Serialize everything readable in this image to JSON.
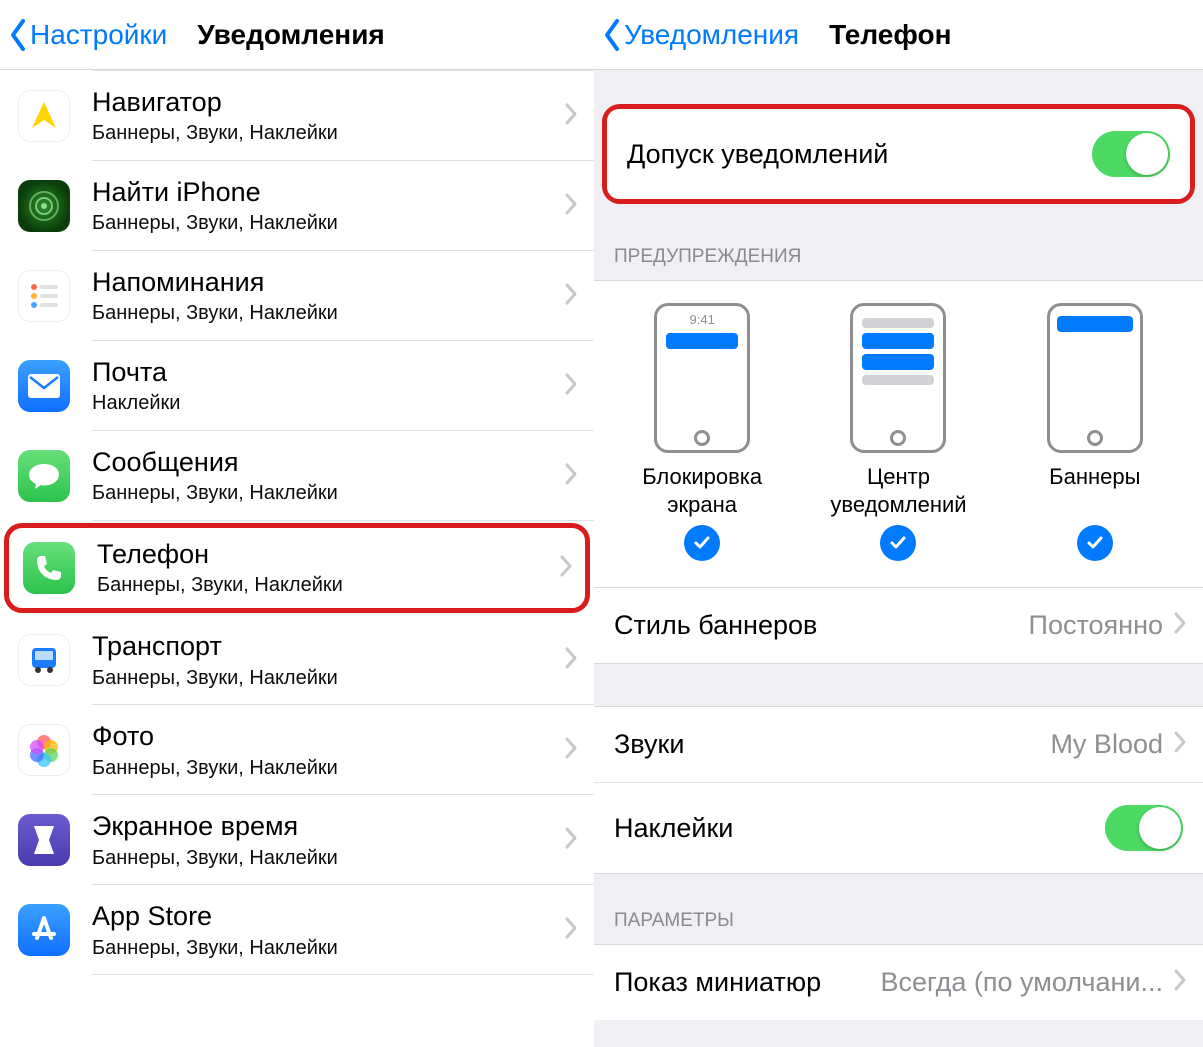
{
  "left": {
    "back": "Настройки",
    "title": "Уведомления",
    "apps": [
      {
        "name": "Навигатор",
        "sub": "Баннеры, Звуки, Наклейки",
        "icon": "navigator"
      },
      {
        "name": "Найти iPhone",
        "sub": "Баннеры, Звуки, Наклейки",
        "icon": "find-iphone"
      },
      {
        "name": "Напоминания",
        "sub": "Баннеры, Звуки, Наклейки",
        "icon": "reminders"
      },
      {
        "name": "Почта",
        "sub": "Наклейки",
        "icon": "mail"
      },
      {
        "name": "Сообщения",
        "sub": "Баннеры, Звуки, Наклейки",
        "icon": "messages"
      },
      {
        "name": "Телефон",
        "sub": "Баннеры, Звуки, Наклейки",
        "icon": "phone",
        "highlighted": true
      },
      {
        "name": "Транспорт",
        "sub": "Баннеры, Звуки, Наклейки",
        "icon": "transport"
      },
      {
        "name": "Фото",
        "sub": "Баннеры, Звуки, Наклейки",
        "icon": "photos"
      },
      {
        "name": "Экранное время",
        "sub": "Баннеры, Звуки, Наклейки",
        "icon": "screentime"
      },
      {
        "name": "App Store",
        "sub": "Баннеры, Звуки, Наклейки",
        "icon": "appstore"
      }
    ]
  },
  "right": {
    "back": "Уведомления",
    "title": "Телефон",
    "allow_label": "Допуск уведомлений",
    "allow_on": true,
    "section_alerts": "ПРЕДУПРЕЖДЕНИЯ",
    "mock_time": "9:41",
    "alert_labels": [
      "Блокировка экрана",
      "Центр уведомлений",
      "Баннеры"
    ],
    "banner_style_label": "Стиль баннеров",
    "banner_style_value": "Постоянно",
    "sounds_label": "Звуки",
    "sounds_value": "My Blood",
    "badges_label": "Наклейки",
    "badges_on": true,
    "section_params": "ПАРАМЕТРЫ",
    "preview_label": "Показ миниатюр",
    "preview_value": "Всегда (по умолчани..."
  }
}
